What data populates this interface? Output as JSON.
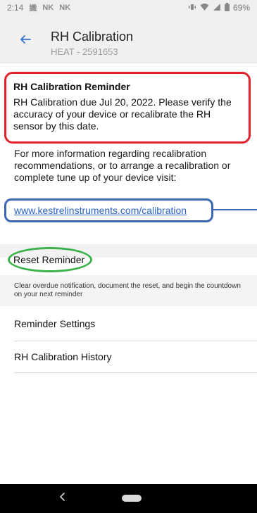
{
  "status_bar": {
    "time": "2:14",
    "left_icons": [
      "識",
      "NK",
      "NK"
    ],
    "battery": "69%"
  },
  "header": {
    "title": "RH Calibration",
    "subtitle": "HEAT - 2591653"
  },
  "reminder": {
    "title": "RH Calibration Reminder",
    "body": "RH Calibration due Jul 20, 2022. Please verify the accuracy of your device or recalibrate the RH sensor by this date."
  },
  "info": {
    "text": "For more information regarding recalibration recommendations, or to arrange a recalibration or complete tune up of your device visit:",
    "link": "www.kestrelinstruments.com/calibration"
  },
  "reset": {
    "label": "Reset Reminder",
    "description": "Clear overdue notification, document the reset, and begin the countdown on your next reminder"
  },
  "menu": {
    "items": [
      {
        "label": "Reminder Settings"
      },
      {
        "label": "RH Calibration History"
      }
    ]
  },
  "colors": {
    "annotation_red": "#e2222b",
    "annotation_blue": "#3b66b3",
    "annotation_green": "#3bb24a",
    "link": "#2a63c2",
    "back_arrow": "#3a6fd1"
  }
}
